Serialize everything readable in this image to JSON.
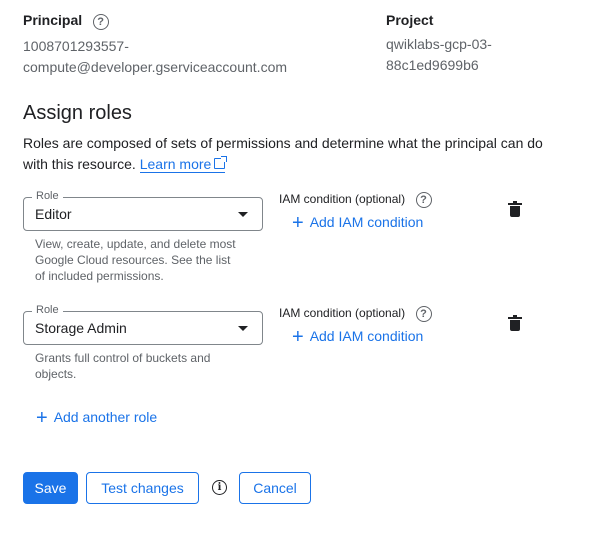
{
  "principal": {
    "label": "Principal",
    "line1": "1008701293557-",
    "line2": "compute@developer.gserviceaccount.com"
  },
  "project": {
    "label": "Project",
    "line1": "qwiklabs-gcp-03-",
    "line2": "88c1ed9699b6"
  },
  "assign_roles": {
    "heading": "Assign roles",
    "description": "Roles are composed of sets of permissions and determine what the principal can do with this resource.",
    "learn_more": "Learn more"
  },
  "roles": [
    {
      "field_label": "Role",
      "value": "Editor",
      "hint": "View, create, update, and delete most Google Cloud resources. See the list of included permissions.",
      "condition_label": "IAM condition (optional)",
      "add_condition": "Add IAM condition"
    },
    {
      "field_label": "Role",
      "value": "Storage Admin",
      "hint": "Grants full control of buckets and objects.",
      "condition_label": "IAM condition (optional)",
      "add_condition": "Add IAM condition"
    }
  ],
  "add_another_role": "Add another role",
  "actions": {
    "save": "Save",
    "test_changes": "Test changes",
    "cancel": "Cancel"
  },
  "icons": {
    "help": "?",
    "info": "i",
    "plus": "+"
  },
  "colors": {
    "accent": "#1a73e8",
    "text": "#202124",
    "muted": "#5f6368"
  }
}
